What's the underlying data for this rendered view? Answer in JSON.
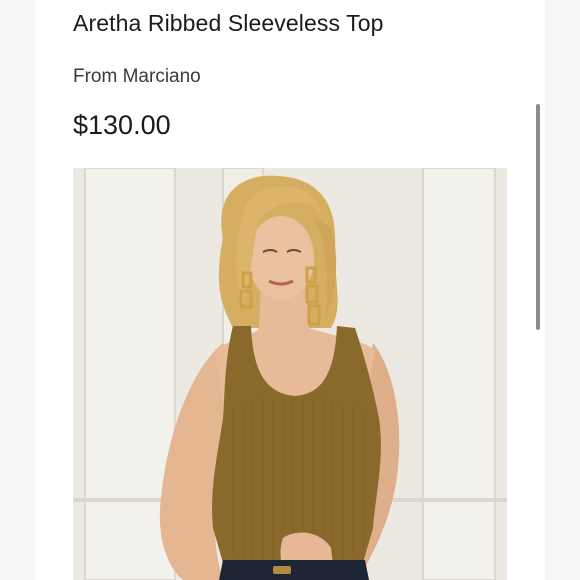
{
  "product": {
    "title": "Aretha Ribbed Sleeveless Top",
    "brand_line": "From Marciano",
    "price": "$130.00"
  },
  "image": {
    "subject": "model-wearing-olive-ribbed-tank-top",
    "colors": {
      "wall": "#ece9e2",
      "panel": "#f4f2ed",
      "hair": "#d9b36a",
      "skin": "#e6b896",
      "top": "#8a6a2c",
      "jeans": "#1d2535",
      "earring": "#c9a24a"
    }
  },
  "colors": {
    "page_bg": "#ffffff",
    "outer_bg": "#f7f7f7",
    "text": "#1b1b1b",
    "muted_text": "#3a3a3a",
    "scrollbar": "#8c8c8c"
  }
}
